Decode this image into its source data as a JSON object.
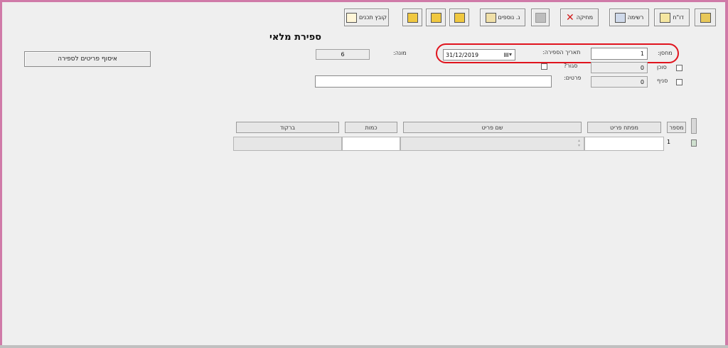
{
  "toolbar": {
    "report": "דו\"ח",
    "list": "רשימה",
    "delete": "מחיקה",
    "additional": "נ. נוספים",
    "select_file": "קובץ תכנים"
  },
  "page": {
    "title": "ספירת מלאי",
    "collect_button": "איסוף פריטים לספירה"
  },
  "form": {
    "warehouse_label": "מחסן:",
    "warehouse_value": "1",
    "count_date_label": "תאריך הספירה:",
    "count_date_value": "31/12/2019",
    "counter_label": "מונה:",
    "counter_value": "6",
    "closed_label": "סגור?",
    "total_label": "סוכן",
    "total_value": "0",
    "branch_label": "סניף",
    "branch_value": "0",
    "details_label": "פרטים:"
  },
  "grid": {
    "headers": {
      "number": "מספר",
      "item_key": "מפתח פריט",
      "item_name": "שם פריט",
      "quantity": "כמות",
      "barcode": "ברקוד"
    },
    "rows": [
      {
        "number": "1"
      }
    ]
  }
}
